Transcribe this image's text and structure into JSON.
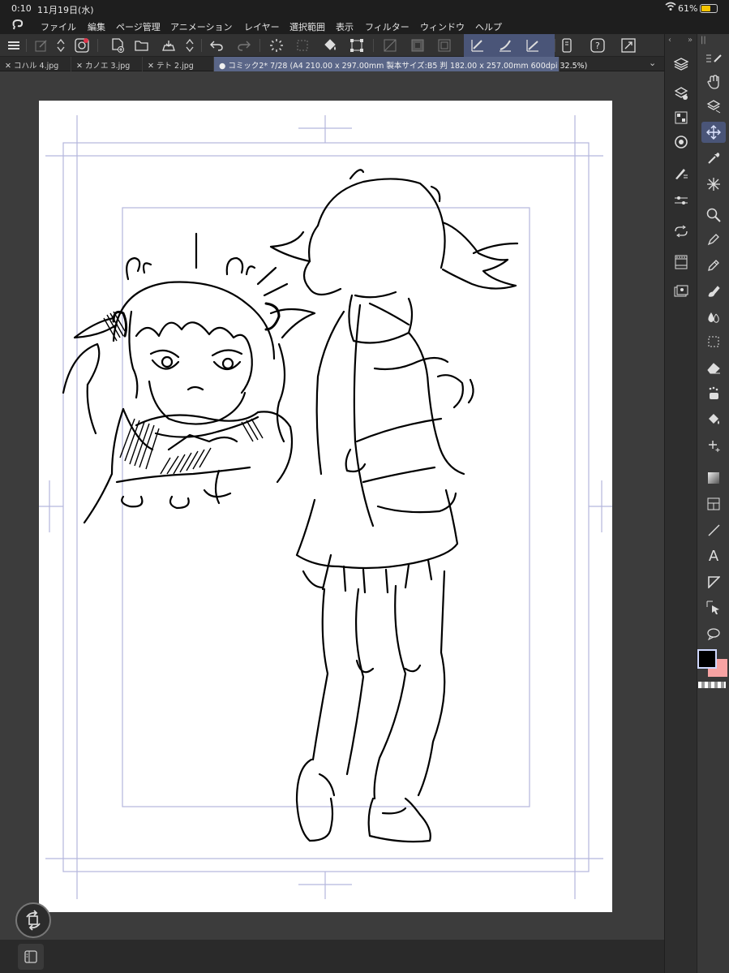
{
  "status_bar": {
    "time": "0:10",
    "date": "11月19日(水)",
    "battery": "61%"
  },
  "menu": {
    "items": [
      "ファイル",
      "編集",
      "ページ管理",
      "アニメーション",
      "レイヤー",
      "選択範囲",
      "表示",
      "フィルター",
      "ウィンドウ",
      "ヘルプ"
    ]
  },
  "tabs": [
    {
      "label": "コハル 4.jpg",
      "active": false
    },
    {
      "label": "カノエ 3.jpg",
      "active": false
    },
    {
      "label": "テト 2.jpg",
      "active": false
    },
    {
      "label": "コミック2* 7/28 (A4 210.00 x 297.00mm 製本サイズ:B5 判 182.00 x 257.00mm 600dpi 32.5%)",
      "active": true
    }
  ],
  "colors": {
    "main_color": "#000000",
    "sub_color": "#f7a3a3",
    "active_accent": "#4a5578"
  }
}
